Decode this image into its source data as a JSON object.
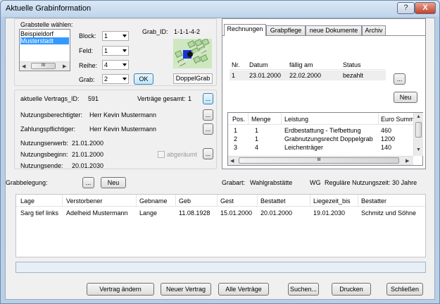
{
  "window": {
    "title": "Aktuelle Grabinformation",
    "help": "?",
    "close": "X"
  },
  "grabstelle": {
    "label": "Grabstelle wählen:",
    "items": [
      "Beispieldorf",
      "Musterstadt"
    ],
    "selected_index": 1,
    "block_label": "Block:",
    "block_value": "1",
    "feld_label": "Feld:",
    "feld_value": "1",
    "reihe_label": "Reihe:",
    "reihe_value": "4",
    "grab_label": "Grab:",
    "grab_value": "2",
    "ok_label": "OK",
    "grab_id_label": "Grab_ID:",
    "grab_id_value": "1-1-1-4-2",
    "grab_type": "DoppelGrab",
    "scroll_mid": "III"
  },
  "vertrag": {
    "vertrags_id_label": "aktuelle Vertrags_ID:",
    "vertrags_id_value": "591",
    "gesamt_label": "Verträge gesamt:",
    "gesamt_value": "1",
    "nutzungsberechtigter_label": "Nutzungsberechtigter:",
    "nutzungsberechtigter_value": "Herr  Kevin Mustermann",
    "zahlungspflichtiger_label": "Zahlungspflichtiger:",
    "zahlungspflichtiger_value": "Herr  Kevin Mustermann",
    "nutzungserwerb_label": "Nutzungserwerb:",
    "nutzungserwerb_value": "21.01.2000",
    "nutzungsbeginn_label": "Nutzungsbeginn:",
    "nutzungsbeginn_value": "21.01.2000",
    "nutzungsende_label": "Nutzungsende:",
    "nutzungsende_value": "20.01.2030",
    "abgeraeumt_label": "abgeräumt",
    "dots": "..."
  },
  "tabs": [
    "Rechnungen",
    "Grabpflege",
    "neue Dokumente",
    "Archiv"
  ],
  "rechnungen": {
    "headers": [
      "Nr.",
      "Datum",
      "fällig am",
      "Status"
    ],
    "rows": [
      [
        "1",
        "23.01.2000",
        "22.02.2000",
        "bezahlt"
      ]
    ],
    "dots": "...",
    "neu_label": "Neu"
  },
  "positionen": {
    "headers": [
      "Pos.",
      "Menge",
      "Leistung",
      "Euro Summ"
    ],
    "rows": [
      [
        "1",
        "1",
        "Erdbestattung - Tiefbettung",
        "460"
      ],
      [
        "2",
        "1",
        "Grabnutzungsrecht Doppelgrab",
        "1200"
      ],
      [
        "3",
        "4",
        "Leichenträger",
        "140"
      ]
    ],
    "scroll_mid": "III"
  },
  "grabbelegung": {
    "label": "Grabbelegung:",
    "dots": "...",
    "neu_label": "Neu",
    "grabart_label": "Grabart:",
    "grabart_value": "Wahlgrabstätte",
    "wg_label": "WG",
    "nutzungszeit_label": "Reguläre Nutzungszeit: 30 Jahre"
  },
  "belegung_table": {
    "headers": [
      "Lage",
      "Verstorbener",
      "Gebname",
      "Geb",
      "Gest",
      "Bestattet",
      "Liegezeit_bis",
      "Bestatter"
    ],
    "rows": [
      [
        "Sarg tief links",
        "Adelheid Mustermann",
        "Lange",
        "11.08.1928",
        "15.01.2000",
        "20.01.2000",
        "19.01.2030",
        "Schmitz und Söhne"
      ]
    ]
  },
  "footer": {
    "vertrag_aendern": "Vertrag ändern",
    "neuer_vertrag": "Neuer Vertrag",
    "alle_vertraege": "Alle Verträge",
    "suchen": "Suchen...",
    "drucken": "Drucken",
    "schliessen": "Schließen"
  }
}
